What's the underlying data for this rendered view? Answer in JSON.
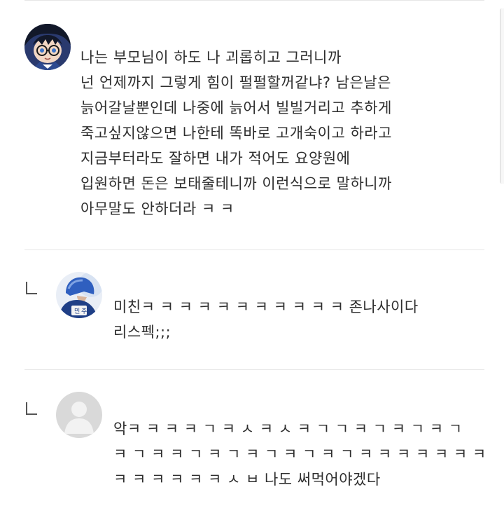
{
  "comments": [
    {
      "avatar_icon": "anime-character-avatar-icon",
      "text": "나는 부모님이 하도 나 괴롭히고 그러니까\n넌 언제까지 그렇게 힘이 펄펄할꺼같냐? 남은날은\n늙어갈날뿐인데 나중에 늙어서 빌빌거리고 추하게\n죽고싶지않으면 나한테 똑바로 고개숙이고 하라고\n지금부터라도 잘하면 내가 적어도 요양원에\n입원하면 돈은 보태줄테니까 이런식으로 말하니까\n아무말도 안하더라 ㅋ ㅋ"
    },
    {
      "avatar_icon": "police-uniform-avatar-icon",
      "reply_icon": "reply-arrow-icon",
      "text": "미친ㅋ ㅋ ㅋ ㅋ ㅋ ㅋ ㅋ ㅋ ㅋ ㅋ ㅋ 존나사이다\n리스펙;;;"
    },
    {
      "avatar_icon": "default-user-avatar-icon",
      "reply_icon": "reply-arrow-icon",
      "text": "악ㅋ ㅋ ㅋ ㅋ ㄱ ㅋ ㅅ ㅋ ㅅ ㅋ ㄱ ㄱ ㅋ ㄱ ㅋ ㄱ ㅋ ㄱ\nㅋ ㄱ ㅋ ㅋ ㄱ ㅋ ㄱ ㅋ ㄱ ㅋ ㄱ ㅋ ㄱ ㅋ ㅋ ㅋ ㅋ ㅋ ㅋ ㅋ\nㅋ ㅋ ㅋ ㅋ ㅋ ㅋ ㅅ ㅂ 나도 써먹어야겠다"
    }
  ],
  "colors": {
    "divider": "#e6e6e6",
    "text": "#2e2e2e",
    "default_avatar_bg": "#d9d9d9"
  }
}
